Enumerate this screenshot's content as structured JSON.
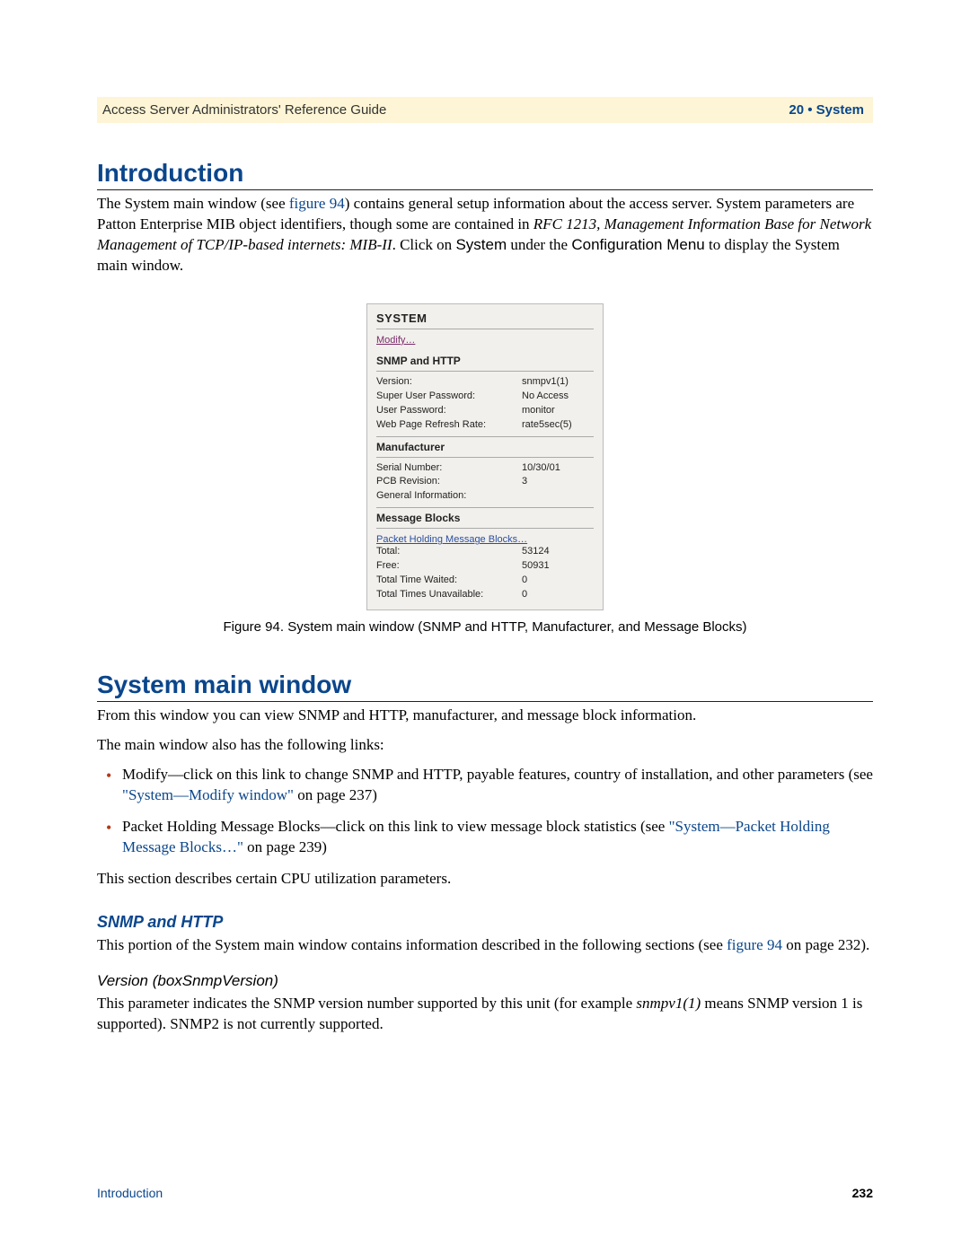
{
  "header": {
    "left": "Access Server Administrators' Reference Guide",
    "right": "20 • System"
  },
  "intro": {
    "heading": "Introduction",
    "p1_a": "The System main window (see ",
    "p1_link": "figure 94",
    "p1_b": ") contains general setup information about the access server. System parameters are Patton Enterprise MIB object identifiers, though some are contained in ",
    "p1_ital": "RFC 1213, Management Information Base for Network Management of TCP/IP-based internets: MIB-II",
    "p1_c": ". Click on ",
    "p1_sans": "System",
    "p1_d": " under the ",
    "p1_sans2": "Configuration Menu",
    "p1_e": " to display the System main window."
  },
  "panel": {
    "title": "SYSTEM",
    "modify": "Modify…",
    "sect1": "SNMP and HTTP",
    "rows1": [
      {
        "k": "Version:",
        "v": "snmpv1(1)"
      },
      {
        "k": "Super User Password:",
        "v": "No Access"
      },
      {
        "k": "User Password:",
        "v": "monitor"
      },
      {
        "k": "Web Page Refresh Rate:",
        "v": "rate5sec(5)"
      }
    ],
    "sect2": "Manufacturer",
    "rows2": [
      {
        "k": "Serial Number:",
        "v": "10/30/01"
      },
      {
        "k": "PCB Revision:",
        "v": "3"
      },
      {
        "k": "General Information:",
        "v": ""
      }
    ],
    "sect3": "Message Blocks",
    "phmb": "Packet Holding Message Blocks…",
    "rows3": [
      {
        "k": "Total:",
        "v": "53124"
      },
      {
        "k": "Free:",
        "v": "50931"
      },
      {
        "k": "Total Time Waited:",
        "v": "0"
      },
      {
        "k": "Total Times Unavailable:",
        "v": "0"
      }
    ]
  },
  "caption": "Figure 94. System main window (SNMP and HTTP, Manufacturer, and Message Blocks)",
  "smw": {
    "heading": "System main window",
    "p1": "From this window you can view SNMP and HTTP, manufacturer, and message block information.",
    "p2": "The main window also has the following links:",
    "bullets": [
      {
        "pre": "Modify—click on this link to change SNMP and HTTP, payable features, country of installation, and other parameters (see ",
        "link": "\"System—Modify window\"",
        "post": " on page 237)"
      },
      {
        "pre": "Packet Holding Message Blocks—click on this link to view message block statistics (see ",
        "link": "\"System—Packet Holding Message Blocks…\"",
        "post": " on page 239)"
      }
    ],
    "p3": "This section describes certain CPU utilization parameters."
  },
  "snmp": {
    "heading": "SNMP and HTTP",
    "p1_a": "This portion of the System main window contains information described in the following sections (see ",
    "p1_link": "figure 94",
    "p1_b": " on page 232).",
    "sub_heading": "Version (boxSnmpVersion)",
    "p2_a": "This parameter indicates the SNMP version number supported by this unit (for example ",
    "p2_ital": "snmpv1(1)",
    "p2_b": " means SNMP version 1 is supported). SNMP2 is not currently supported."
  },
  "footer": {
    "left": "Introduction",
    "right": "232"
  }
}
